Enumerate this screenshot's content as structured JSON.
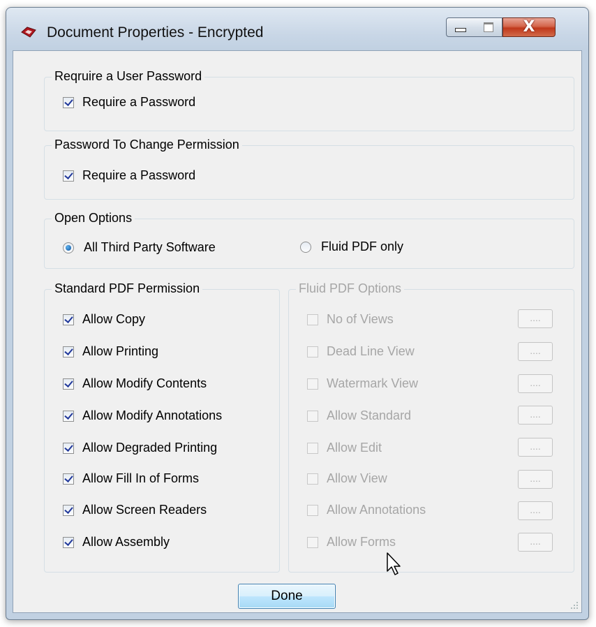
{
  "window": {
    "title": "Document Properties - Encrypted",
    "icon": "pdf-app-icon",
    "controls": {
      "minimize": "minimize-icon",
      "maximize": "maximize-icon",
      "close": "X"
    }
  },
  "user_password": {
    "title": "Reqruire a User Password",
    "checkbox_label": "Require a Password",
    "checked": true
  },
  "permission_password": {
    "title": "Password To Change Permission",
    "checkbox_label": "Require a Password",
    "checked": true
  },
  "open_options": {
    "title": "Open Options",
    "options": [
      {
        "label": "All Third Party Software",
        "selected": true
      },
      {
        "label": "Fluid PDF only",
        "selected": false
      }
    ]
  },
  "standard_permissions": {
    "title": "Standard PDF Permission",
    "items": [
      {
        "label": "Allow Copy",
        "checked": true
      },
      {
        "label": "Allow Printing",
        "checked": true
      },
      {
        "label": "Allow Modify Contents",
        "checked": true
      },
      {
        "label": "Allow Modify Annotations",
        "checked": true
      },
      {
        "label": "Allow Degraded Printing",
        "checked": true
      },
      {
        "label": "Allow Fill In of Forms",
        "checked": true
      },
      {
        "label": "Allow Screen Readers",
        "checked": true
      },
      {
        "label": "Allow Assembly",
        "checked": true
      }
    ]
  },
  "fluid_options": {
    "title": "Fluid PDF Options",
    "enabled": false,
    "button_label": "....",
    "items": [
      {
        "label": "No of Views",
        "checked": false
      },
      {
        "label": "Dead Line View",
        "checked": false
      },
      {
        "label": "Watermark View",
        "checked": false
      },
      {
        "label": "Allow Standard",
        "checked": false
      },
      {
        "label": "Allow Edit",
        "checked": false
      },
      {
        "label": "Allow View",
        "checked": false
      },
      {
        "label": "Allow Annotations",
        "checked": false
      },
      {
        "label": "Allow Forms",
        "checked": false
      }
    ]
  },
  "footer": {
    "done_label": "Done"
  },
  "colors": {
    "accent": "#21389a",
    "disabled_text": "#a6a6a6",
    "close_red": "#c0381b"
  }
}
